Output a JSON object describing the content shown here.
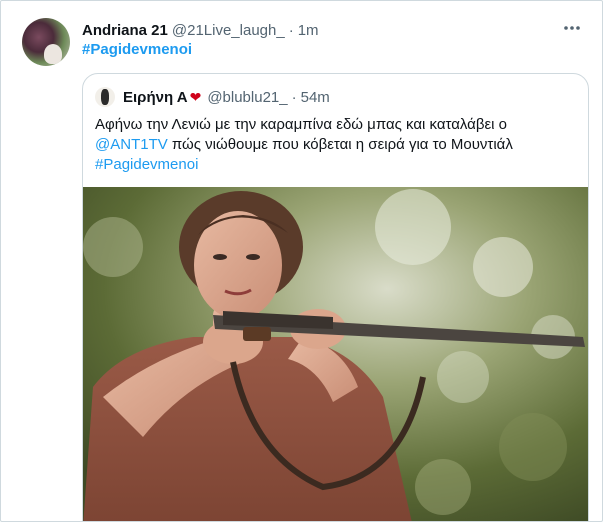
{
  "tweet": {
    "display_name": "Andriana 21",
    "handle": "@21Live_laugh_",
    "separator": "·",
    "time": "1m",
    "hashtag": "#Pagidevmenoi",
    "more_icon": "more-horizontal-icon"
  },
  "quoted_tweet": {
    "display_name": "Ειρήνη Α",
    "emoji": "❤",
    "handle": "@blublu21_",
    "separator": "·",
    "time": "54m",
    "text_line1": "Αφήνω την Λενιώ με την καραμπίνα εδώ μπας και καταλάβει ο",
    "mention": "@ANT1TV",
    "text_line2_rest": " πώς νιώθουμε που κόβεται η σειρά για το Μουντιάλ",
    "hashtag": "#Pagidevmenoi"
  },
  "colors": {
    "link": "#1d9bf0",
    "secondary_text": "#536471",
    "border": "#cfd9de",
    "heart": "#d0021b"
  }
}
